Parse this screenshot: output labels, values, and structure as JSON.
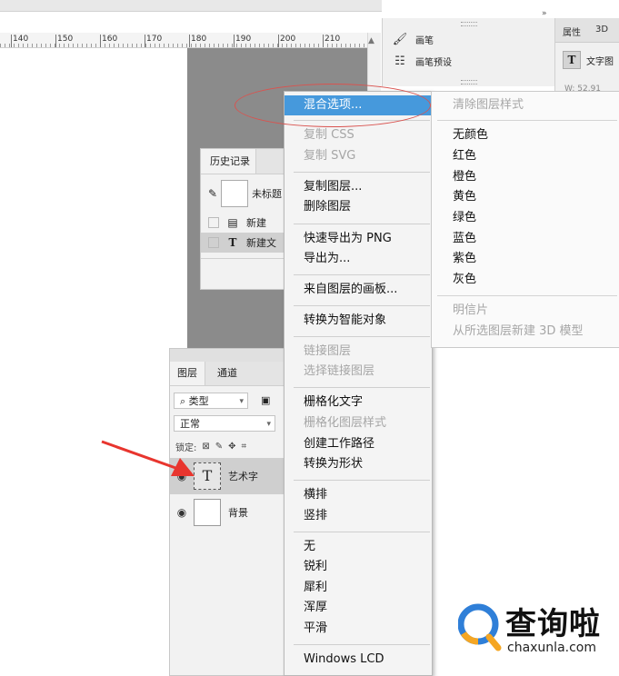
{
  "ruler": {
    "ticks": [
      "140",
      "150",
      "160",
      "170",
      "180",
      "190",
      "200",
      "210"
    ]
  },
  "brush_panel": {
    "items": [
      {
        "label": "画笔",
        "icon": "brush-icon"
      },
      {
        "label": "画笔预设",
        "icon": "brush-preset-icon"
      }
    ]
  },
  "properties_panel": {
    "tabs": [
      "属性",
      "3D"
    ],
    "type_label": "文字图",
    "width_value": "W: 52.91"
  },
  "history_panel": {
    "tab": "历史记录",
    "snapshot": "未标题",
    "steps": [
      {
        "label": "新建",
        "icon": "document-icon"
      },
      {
        "label": "新建文",
        "icon": "text-tool-icon"
      }
    ]
  },
  "layers_panel": {
    "tabs": [
      "图层",
      "通道"
    ],
    "filter_kind": "类型",
    "blend_mode": "正常",
    "lock_label": "锁定:",
    "layers": [
      {
        "name": "艺术字",
        "type": "text",
        "thumb": "T"
      },
      {
        "name": "背景",
        "type": "pixel",
        "thumb": ""
      }
    ]
  },
  "context_menu": {
    "items": [
      {
        "label": "混合选项...",
        "state": "selected"
      },
      {
        "label": "复制 CSS",
        "state": "disabled"
      },
      {
        "label": "复制 SVG",
        "state": "disabled"
      },
      {
        "label": "复制图层...",
        "state": "enabled"
      },
      {
        "label": "删除图层",
        "state": "enabled"
      },
      {
        "label": "快速导出为 PNG",
        "state": "enabled"
      },
      {
        "label": "导出为...",
        "state": "enabled"
      },
      {
        "label": "来自图层的画板...",
        "state": "enabled"
      },
      {
        "label": "转换为智能对象",
        "state": "enabled"
      },
      {
        "label": "链接图层",
        "state": "disabled"
      },
      {
        "label": "选择链接图层",
        "state": "disabled"
      },
      {
        "label": "栅格化文字",
        "state": "enabled"
      },
      {
        "label": "栅格化图层样式",
        "state": "disabled"
      },
      {
        "label": "创建工作路径",
        "state": "enabled"
      },
      {
        "label": "转换为形状",
        "state": "enabled"
      },
      {
        "label": "横排",
        "state": "enabled"
      },
      {
        "label": "竖排",
        "state": "enabled"
      },
      {
        "label": "无",
        "state": "enabled"
      },
      {
        "label": "锐利",
        "state": "enabled"
      },
      {
        "label": "犀利",
        "state": "enabled"
      },
      {
        "label": "浑厚",
        "state": "enabled"
      },
      {
        "label": "平滑",
        "state": "enabled"
      },
      {
        "label": "Windows LCD",
        "state": "enabled"
      }
    ]
  },
  "submenu": {
    "items": [
      {
        "label": "清除图层样式",
        "state": "disabled"
      },
      {
        "label": "无颜色",
        "state": "enabled"
      },
      {
        "label": "红色",
        "state": "enabled"
      },
      {
        "label": "橙色",
        "state": "enabled"
      },
      {
        "label": "黄色",
        "state": "enabled"
      },
      {
        "label": "绿色",
        "state": "enabled"
      },
      {
        "label": "蓝色",
        "state": "enabled"
      },
      {
        "label": "紫色",
        "state": "enabled"
      },
      {
        "label": "灰色",
        "state": "enabled"
      },
      {
        "label": "明信片",
        "state": "disabled"
      },
      {
        "label": "从所选图层新建 3D 模型",
        "state": "disabled"
      }
    ]
  },
  "watermark": {
    "name": "查询啦",
    "url": "chaxunla.com"
  },
  "colors": {
    "highlight": "#4699dc",
    "annotation": "#d9534f",
    "logo_blue": "#2f7fd8",
    "logo_orange": "#f5a623"
  }
}
